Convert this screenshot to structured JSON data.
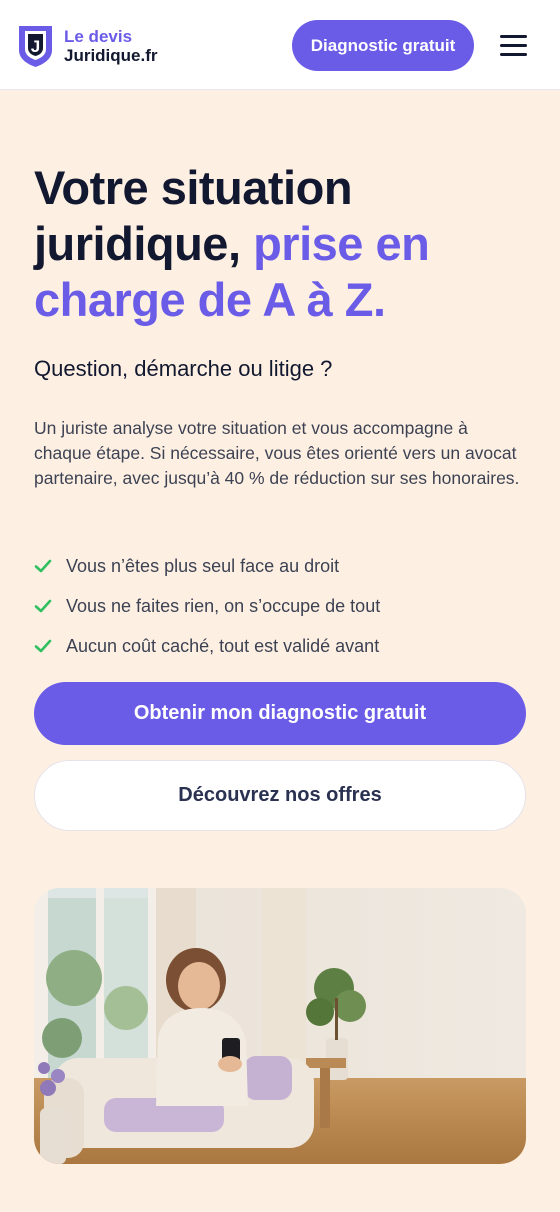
{
  "header": {
    "logo_line1": "Le devis",
    "logo_line2": "Juridique.fr",
    "logo_letter": "J",
    "cta_label": "Diagnostic gratuit",
    "menu_icon": "hamburger-menu-icon"
  },
  "hero": {
    "title_part1": "Votre situation juridique,",
    "title_accent": "prise en charge de A à Z.",
    "subtitle": "Question, démarche ou litige ?",
    "description": "Un juriste analyse votre situation et vous accompagne à chaque étape. Si nécessaire, vous êtes orienté vers un avocat partenaire, avec jusqu’à 40 % de réduction sur ses honoraires.",
    "features": [
      {
        "icon": "check-icon",
        "text": "Vous n’êtes plus seul face au droit"
      },
      {
        "icon": "check-icon",
        "text": "Vous ne faites rien, on s’occupe de tout"
      },
      {
        "icon": "check-icon",
        "text": "Aucun coût caché, tout est validé avant"
      }
    ],
    "primary_button": "Obtenir mon diagnostic gratuit",
    "secondary_button": "Découvrez nos offres"
  },
  "colors": {
    "accent": "#6b5ce7",
    "dark": "#12182f",
    "background": "#fdf0e3",
    "check": "#2fbf5f"
  }
}
